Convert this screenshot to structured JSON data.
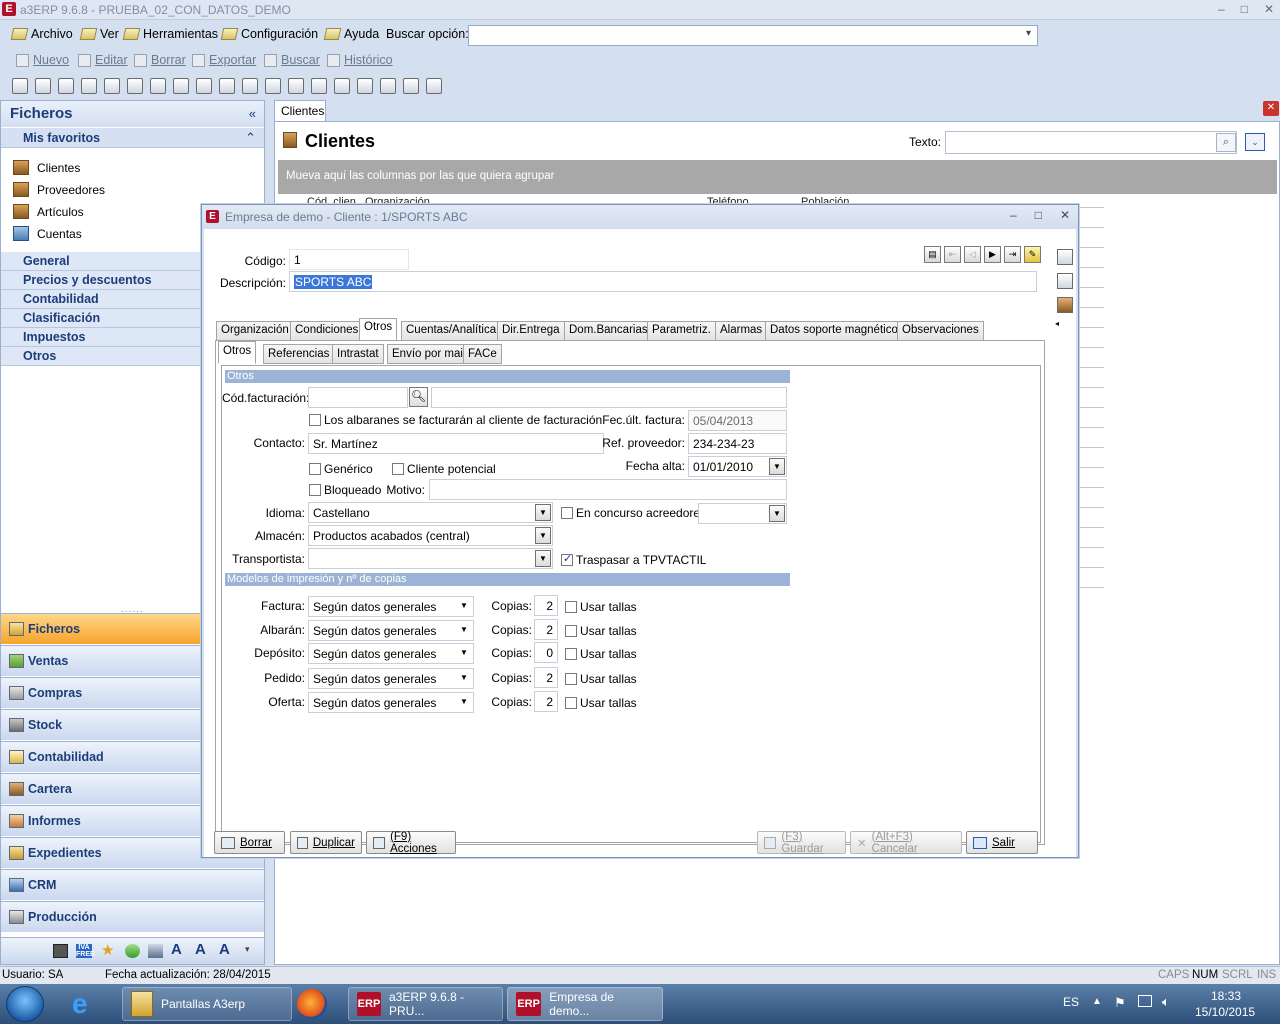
{
  "app": {
    "title": "a3ERP 9.6.8 - PRUEBA_02_CON_DATOS_DEMO",
    "logo": "E",
    "window_buttons": [
      "–",
      "□",
      "✕"
    ]
  },
  "menu": {
    "items": [
      "Archivo",
      "Ver",
      "Herramientas",
      "Configuración",
      "Ayuda"
    ],
    "search_label": "Buscar opción:"
  },
  "toolbar2": [
    "Nuevo",
    "Editar",
    "Borrar",
    "Exportar",
    "Buscar",
    "Histórico"
  ],
  "left": {
    "title": "Ficheros",
    "favorites_title": "Mis favoritos",
    "favorites": [
      "Clientes",
      "Proveedores",
      "Artículos",
      "Cuentas"
    ],
    "sections": [
      "General",
      "Precios y descuentos",
      "Contabilidad",
      "Clasificación",
      "Impuestos",
      "Otros"
    ],
    "nav": [
      "Ficheros",
      "Ventas",
      "Compras",
      "Stock",
      "Contabilidad",
      "Cartera",
      "Informes",
      "Expedientes",
      "CRM",
      "Producción"
    ],
    "bottom_iva": "IVA FREE"
  },
  "clients": {
    "tab": "Clientes",
    "title": "Clientes",
    "texto_label": "Texto:",
    "group_hint": "Mueva aquí las columnas por las que quiera agrupar",
    "columns": [
      "Cód. clien.",
      "Organización",
      "Teléfono",
      "Población"
    ]
  },
  "dialog": {
    "title": "Empresa de demo - Cliente : 1/SPORTS ABC",
    "logo": "E",
    "codigo_label": "Código:",
    "codigo_value": "1",
    "descripcion_label": "Descripción:",
    "descripcion_value": "SPORTS ABC",
    "tabs": [
      "Organización",
      "Condiciones",
      "Otros",
      "Cuentas/Analítica",
      "Dir.Entrega",
      "Dom.Bancarias",
      "Parametriz.",
      "Alarmas",
      "Datos soporte magnético",
      "Observaciones"
    ],
    "subtabs": [
      "Otros",
      "Referencias",
      "Intrastat",
      "Envío por mail",
      "FACe"
    ],
    "section_otros": "Otros",
    "cod_facturacion_label": "Cód.facturación:",
    "albaranes_label": "Los albaranes se facturarán al cliente de facturación",
    "fec_ult_factura_label": "Fec.últ. factura:",
    "fec_ult_factura_value": "05/04/2013",
    "contacto_label": "Contacto:",
    "contacto_value": "Sr. Martínez",
    "ref_proveedor_label": "Ref. proveedor:",
    "ref_proveedor_value": "234-234-23",
    "generico_label": "Genérico",
    "cliente_potencial_label": "Cliente potencial",
    "fecha_alta_label": "Fecha alta:",
    "fecha_alta_value": "01/01/2010",
    "bloqueado_label": "Bloqueado",
    "motivo_label": "Motivo:",
    "idioma_label": "Idioma:",
    "idioma_value": "Castellano",
    "concurso_label": "En concurso acreedores",
    "almacen_label": "Almacén:",
    "almacen_value": "Productos acabados (central)",
    "transportista_label": "Transportista:",
    "tpv_label": "Traspasar a TPVTACTIL",
    "tpv_checked": true,
    "section_modelos": "Modelos de impresión y nº de copias",
    "models": [
      {
        "label": "Factura:",
        "value": "Según datos generales",
        "copias": "2"
      },
      {
        "label": "Albarán:",
        "value": "Según datos generales",
        "copias": "2"
      },
      {
        "label": "Depósito:",
        "value": "Según datos generales",
        "copias": "0"
      },
      {
        "label": "Pedido:",
        "value": "Según datos generales",
        "copias": "2"
      },
      {
        "label": "Oferta:",
        "value": "Según datos generales",
        "copias": "2"
      }
    ],
    "copias_label": "Copias:",
    "usar_tallas_label": "Usar tallas",
    "footer": {
      "borrar": "Borrar",
      "duplicar": "Duplicar",
      "acciones": "(F9) Acciones",
      "guardar": "(F3) Guardar",
      "cancelar": "(Alt+F3) Cancelar",
      "salir": "Salir"
    }
  },
  "status": {
    "user": "Usuario: SA",
    "fecha": "Fecha actualización: 28/04/2015",
    "caps": "CAPS",
    "num": "NUM",
    "scrl": "SCRL",
    "ins": "INS"
  },
  "taskbar": {
    "apps": [
      "Pantallas A3erp",
      "a3ERP 9.6.8 - PRU...",
      "Empresa de demo..."
    ],
    "erp_badge": "ERP",
    "lang": "ES",
    "time": "18:33",
    "date": "15/10/2015"
  }
}
